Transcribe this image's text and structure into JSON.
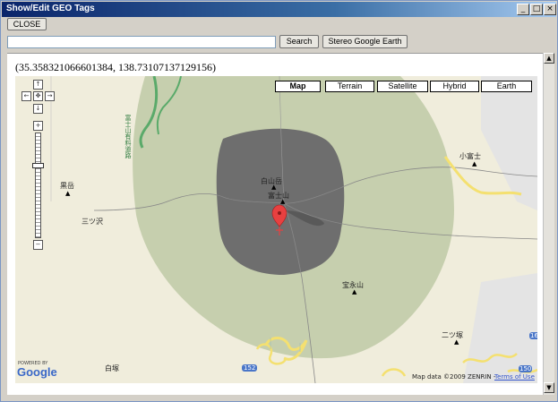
{
  "window": {
    "title": "Show/Edit GEO Tags",
    "minimize": "_",
    "maximize": "□",
    "close": "×"
  },
  "toolbar": {
    "close_label": "CLOSE"
  },
  "search": {
    "value": "",
    "button_label": "Search",
    "stereo_label": "Stereo Google Earth"
  },
  "coords": "(35.358321066601384, 138.73107137129156)",
  "map": {
    "types": [
      "Map",
      "Terrain",
      "Satellite",
      "Hybrid",
      "Earth"
    ],
    "active_type": "Map",
    "labels": {
      "hakusan": "白山岳",
      "fujisan": "富士山",
      "kofuji": "小富士",
      "hoeizan": "宝永山",
      "futatsuzuka": "二ツ塚",
      "kurodake": "黒岳",
      "mitsuzawa": "三ツ沢",
      "shiratsuka": "白塚",
      "road": "富士山有料道路"
    },
    "route_numbers": {
      "r152": "152",
      "r150": "150",
      "r16": "16"
    },
    "logo_powered": "POWERED BY",
    "logo_google": "Google",
    "attribution": "Map data ©2009 ZENRIN -",
    "terms": "Terms of Use"
  },
  "nav": {
    "up": "↑",
    "left": "←",
    "center": "✥",
    "right": "→",
    "down": "↓",
    "zoom_in": "+",
    "zoom_out": "−"
  },
  "scroll": {
    "up": "▲",
    "down": "▼"
  },
  "colors": {
    "titlebar": "#0a246a",
    "map_bg": "#f0eddc",
    "park": "#c6cfae",
    "crater": "#6e6e6e",
    "road_green": "#5aaa6a",
    "contour_yellow": "#f4e070",
    "marker": "#e84040"
  }
}
